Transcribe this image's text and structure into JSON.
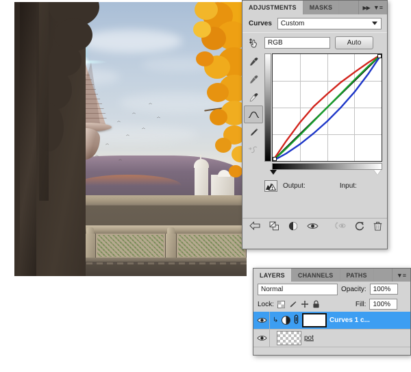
{
  "adjustments_panel": {
    "tabs": [
      {
        "label": "ADJUSTMENTS",
        "active": true
      },
      {
        "label": "MASKS",
        "active": false
      }
    ],
    "collapse_icon": "▶▶",
    "menu_icon": "▼≡",
    "curves_label": "Curves",
    "preset": {
      "value": "Custom",
      "placeholder": "Custom"
    },
    "channel": {
      "value": "RGB"
    },
    "auto_button": "Auto",
    "output_label": "Output:",
    "input_label": "Input:",
    "output_value": "",
    "input_value": "",
    "tools": [
      {
        "name": "scrubby-adjust-tool",
        "glyph": "⇅"
      },
      {
        "name": "eyedropper-black-tool",
        "glyph": ""
      },
      {
        "name": "eyedropper-gray-tool",
        "glyph": ""
      },
      {
        "name": "eyedropper-white-tool",
        "glyph": ""
      },
      {
        "name": "curve-point-tool",
        "glyph": ""
      },
      {
        "name": "pencil-draw-tool",
        "glyph": ""
      },
      {
        "name": "smooth-curve-tool",
        "glyph": "S"
      }
    ],
    "footer_buttons": [
      {
        "name": "return-to-adjustment-list-button"
      },
      {
        "name": "clip-to-layer-button"
      },
      {
        "name": "toggle-layer-mask-button"
      },
      {
        "name": "toggle-layer-visibility-button"
      },
      {
        "name": "preview-previous-state-button"
      },
      {
        "name": "reset-adjustment-button"
      },
      {
        "name": "delete-adjustment-layer-button"
      }
    ]
  },
  "chart_data": {
    "type": "line",
    "title": "Curves",
    "xlabel": "Input",
    "ylabel": "Output",
    "xlim": [
      0,
      255
    ],
    "ylim": [
      0,
      255
    ],
    "grid": true,
    "grid_divisions": 4,
    "legend": "none",
    "series": [
      {
        "name": "Baseline",
        "color": "#000000",
        "points": [
          [
            0,
            0
          ],
          [
            64,
            64
          ],
          [
            128,
            128
          ],
          [
            192,
            192
          ],
          [
            255,
            255
          ]
        ]
      },
      {
        "name": "Red",
        "color": "#d2241c",
        "points": [
          [
            0,
            0
          ],
          [
            32,
            48
          ],
          [
            64,
            92
          ],
          [
            96,
            130
          ],
          [
            128,
            160
          ],
          [
            160,
            188
          ],
          [
            192,
            212
          ],
          [
            224,
            235
          ],
          [
            255,
            255
          ]
        ]
      },
      {
        "name": "Green",
        "color": "#18a02c",
        "points": [
          [
            0,
            0
          ],
          [
            32,
            30
          ],
          [
            64,
            62
          ],
          [
            96,
            95
          ],
          [
            128,
            128
          ],
          [
            160,
            161
          ],
          [
            192,
            194
          ],
          [
            224,
            226
          ],
          [
            255,
            255
          ]
        ]
      },
      {
        "name": "Blue",
        "color": "#1d36c8",
        "points": [
          [
            0,
            0
          ],
          [
            32,
            18
          ],
          [
            64,
            40
          ],
          [
            96,
            66
          ],
          [
            128,
            95
          ],
          [
            160,
            128
          ],
          [
            192,
            165
          ],
          [
            224,
            208
          ],
          [
            255,
            255
          ]
        ]
      }
    ],
    "control_points": [
      [
        0,
        0
      ],
      [
        255,
        255
      ]
    ],
    "shadow_marker": 0,
    "highlight_marker": 255
  },
  "layers_panel": {
    "tabs": [
      {
        "label": "LAYERS",
        "active": true
      },
      {
        "label": "CHANNELS",
        "active": false
      },
      {
        "label": "PATHS",
        "active": false
      }
    ],
    "menu_icon": "▼≡",
    "blend_mode": "Normal",
    "opacity_label": "Opacity:",
    "opacity_value": "100%",
    "lock_label": "Lock:",
    "fill_label": "Fill:",
    "fill_value": "100%",
    "lock_buttons": [
      {
        "name": "lock-transparent-pixels-button"
      },
      {
        "name": "lock-image-pixels-button"
      },
      {
        "name": "lock-position-button"
      },
      {
        "name": "lock-all-button"
      }
    ],
    "layers": [
      {
        "name": "Curves 1 c...",
        "selected": true,
        "visible": true,
        "clipped": true,
        "linked": true,
        "thumb": "white-mask"
      },
      {
        "name": "pot",
        "selected": false,
        "visible": true,
        "clipped": false,
        "linked": false,
        "thumb": "transparent"
      }
    ]
  },
  "document": {
    "image_description": "floating temple airship over autumn valley framed by stone arch"
  },
  "colors": {
    "panel_bg": "#d4d4d4",
    "tab_bg_active": "#d4d4d4",
    "tab_bg_inactive": "#9e9e9e",
    "tabbar_bg": "#3f3f3f",
    "selection_blue": "#3d9ef2",
    "curve_red": "#d2241c",
    "curve_green": "#18a02c",
    "curve_blue": "#1d36c8",
    "curve_black": "#000000"
  }
}
